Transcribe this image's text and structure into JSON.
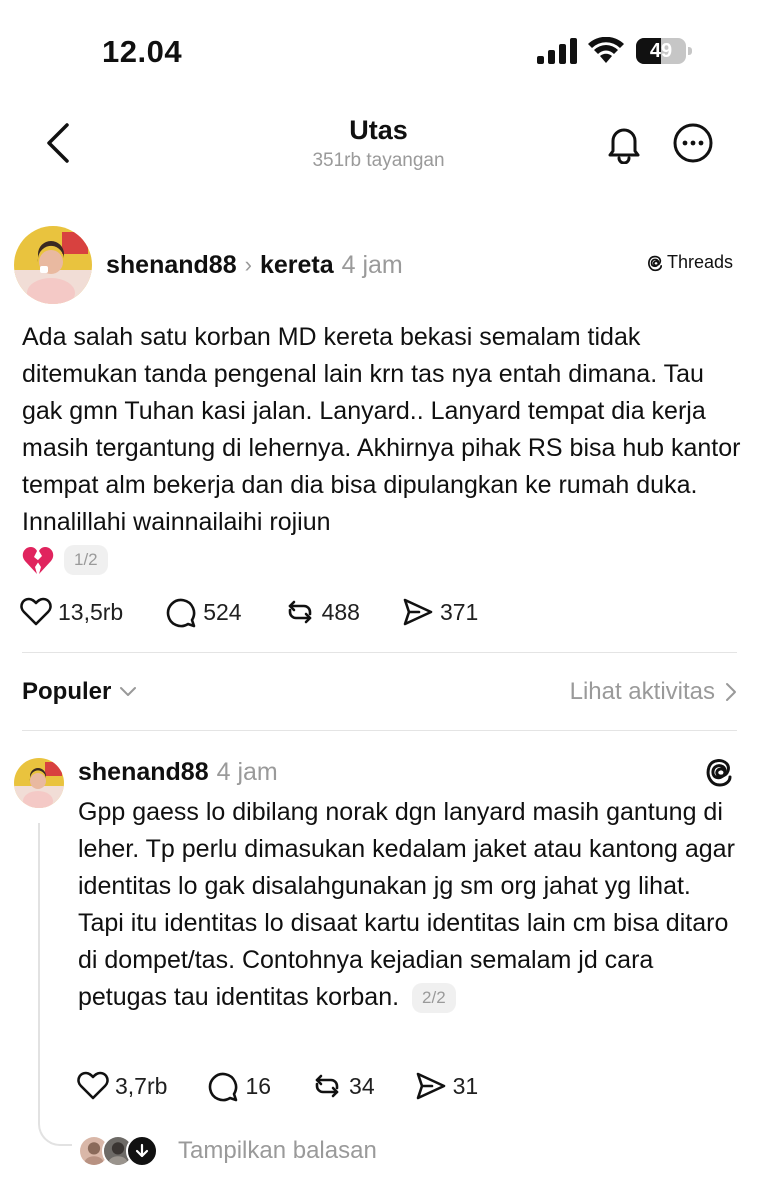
{
  "status_bar": {
    "time": "12.04",
    "battery": "49",
    "battery_level": 0.49
  },
  "header": {
    "title": "Utas",
    "subtitle": "351rb tayangan"
  },
  "post1": {
    "username": "shenand88",
    "topic": "kereta",
    "time": "4 jam",
    "source_label": "Threads",
    "text": "Ada salah satu korban MD kereta bekasi semalam tidak ditemukan tanda pengenal lain krn tas nya entah dimana. Tau gak gmn Tuhan kasi jalan. Lanyard.. Lanyard tempat dia kerja masih tergantung di lehernya. Akhirnya pihak RS bisa hub kantor tempat alm bekerja dan dia bisa dipulangkan ke rumah duka. Innalillahi wainnailaihi rojiun",
    "page_label": "1/2",
    "likes": "13,5rb",
    "comments": "524",
    "reposts": "488",
    "shares": "371"
  },
  "sort": {
    "label": "Populer",
    "activity_link": "Lihat aktivitas"
  },
  "post2": {
    "username": "shenand88",
    "time": "4 jam",
    "text": "Gpp gaess lo dibilang norak dgn lanyard masih gantung di leher. Tp perlu dimasukan kedalam jaket atau kantong agar identitas lo gak disalahgunakan jg sm org jahat yg lihat. Tapi itu identitas lo disaat kartu identitas lain cm bisa ditaro di dompet/tas. Contohnya kejadian semalam jd cara petugas tau identitas korban.",
    "page_label": "2/2",
    "likes": "3,7rb",
    "comments": "16",
    "reposts": "34",
    "shares": "31"
  },
  "replies": {
    "label": "Tampilkan balasan"
  },
  "icons": {
    "back": "chevron-left-icon",
    "bell": "bell-icon",
    "more": "more-icon",
    "like": "heart-icon",
    "comment": "comment-icon",
    "repost": "repost-icon",
    "share": "send-icon",
    "broken_heart": "broken-heart-emoji"
  },
  "colors": {
    "text": "#101010",
    "muted": "#9a9a9a",
    "divider": "#e4e4e4",
    "emoji": "#e0245e"
  }
}
